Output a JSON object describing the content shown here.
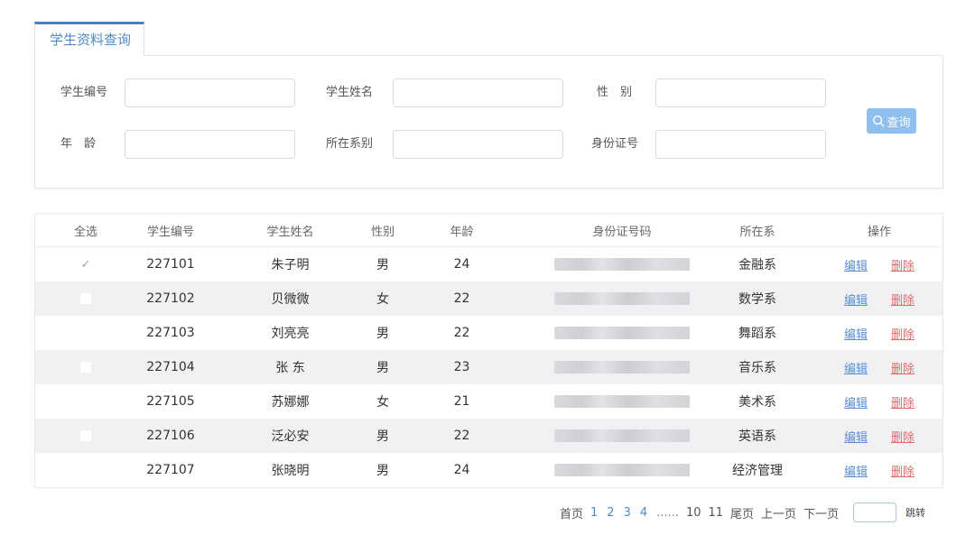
{
  "tab": {
    "label": "学生资料查询"
  },
  "search": {
    "fields": [
      {
        "label": "学生编号",
        "value": ""
      },
      {
        "label": "学生姓名",
        "value": ""
      },
      {
        "label": "性　别",
        "value": ""
      },
      {
        "label": "年　龄",
        "value": ""
      },
      {
        "label": "所在系别",
        "value": ""
      },
      {
        "label": "身份证号",
        "value": ""
      }
    ],
    "query_button": "查询"
  },
  "table": {
    "headers": {
      "select_all": "全选",
      "id": "学生编号",
      "name": "学生姓名",
      "sex": "性别",
      "age": "年龄",
      "idno": "身份证号码",
      "dept": "所在系",
      "ops": "操作"
    },
    "rows": [
      {
        "checked": true,
        "id": "227101",
        "name": "朱子明",
        "sex": "男",
        "age": "24",
        "dept": "金融系"
      },
      {
        "checked": false,
        "id": "227102",
        "name": "贝微微",
        "sex": "女",
        "age": "22",
        "dept": "数学系"
      },
      {
        "checked": false,
        "id": "227103",
        "name": "刘亮亮",
        "sex": "男",
        "age": "22",
        "dept": "舞蹈系"
      },
      {
        "checked": false,
        "id": "227104",
        "name": "张 东",
        "sex": "男",
        "age": "23",
        "dept": "音乐系"
      },
      {
        "checked": false,
        "id": "227105",
        "name": "苏娜娜",
        "sex": "女",
        "age": "21",
        "dept": "美术系"
      },
      {
        "checked": false,
        "id": "227106",
        "name": "泛必安",
        "sex": "男",
        "age": "22",
        "dept": "英语系"
      },
      {
        "checked": false,
        "id": "227107",
        "name": "张晓明",
        "sex": "男",
        "age": "24",
        "dept": "经济管理"
      }
    ],
    "edit_label": "编辑",
    "delete_label": "删除"
  },
  "pager": {
    "first": "首页",
    "pages": [
      "1",
      "2",
      "3",
      "4"
    ],
    "ellipsis": "......",
    "tail_pages": [
      "10",
      "11"
    ],
    "last": "尾页",
    "prev": "上一页",
    "next": "下一页",
    "jump": "跳转"
  },
  "colors": {
    "accent": "#4a8ad0",
    "query_button": "#8fbfef",
    "delete_link": "#e06a6a",
    "alt_row": "#f1f1f3"
  }
}
